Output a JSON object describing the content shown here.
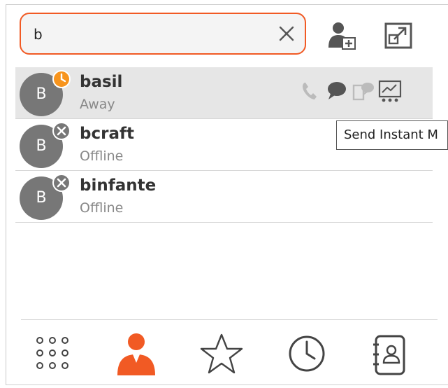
{
  "search": {
    "value": "b",
    "clear_icon": "close-icon"
  },
  "header": {
    "add_contact_icon": "add-contact-icon",
    "popout_icon": "popout-icon"
  },
  "contacts": [
    {
      "initial": "B",
      "name": "basil",
      "status": "Away",
      "presence": "away"
    },
    {
      "initial": "B",
      "name": "bcraft",
      "status": "Offline",
      "presence": "offline"
    },
    {
      "initial": "B",
      "name": "binfante",
      "status": "Offline",
      "presence": "offline"
    }
  ],
  "row_actions": [
    "phone-icon",
    "chat-bubble-icon",
    "share-screen-icon",
    "meeting-icon"
  ],
  "tooltip": {
    "text": "Send Instant M"
  },
  "nav": [
    "dialpad-icon",
    "contacts-icon",
    "favorites-icon",
    "history-icon",
    "directory-icon"
  ],
  "colors": {
    "accent": "#f15a24",
    "away": "#f7941d",
    "avatar": "#777777",
    "selected_row": "#e6e6e6"
  }
}
